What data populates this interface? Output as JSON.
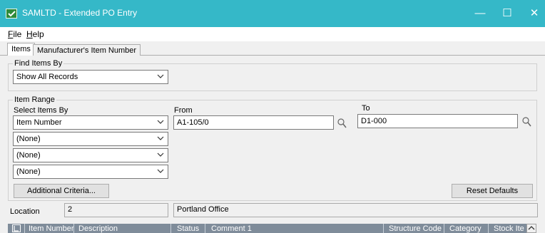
{
  "window": {
    "title": "SAMLTD - Extended PO Entry",
    "minimize_glyph": "—",
    "maximize_glyph": "☐",
    "close_glyph": "✕",
    "accent": "#35b8c8"
  },
  "menu": {
    "file": "File",
    "help": "Help"
  },
  "tabs": [
    {
      "label": "Items",
      "active": true
    },
    {
      "label": "Manufacturer's Item Number",
      "active": false
    }
  ],
  "find_items": {
    "legend": "Find Items By",
    "selected": "Show All Records"
  },
  "item_range": {
    "legend": "Item Range",
    "select_by_label": "Select Items By",
    "from_label": "From",
    "to_label": "To",
    "selectors": [
      "Item Number",
      "(None)",
      "(None)",
      "(None)"
    ],
    "from_value": "A1-105/0",
    "to_value": "D1-000"
  },
  "buttons": {
    "additional_criteria": "Additional Criteria...",
    "reset_defaults": "Reset Defaults"
  },
  "location": {
    "label": "Location",
    "code": "2",
    "name": "Portland Office"
  },
  "grid": {
    "columns": [
      "Item Number",
      "Description",
      "Status",
      "Comment 1",
      "Structure Code",
      "Category",
      "Stock Ite"
    ]
  },
  "icons": {
    "app": "app-check-icon",
    "lookup": "magnifier-icon",
    "dropdown": "chevron-down-icon",
    "grid_corner": "grid-select-icon",
    "scroll": "scroll-up-arrow-icon"
  }
}
